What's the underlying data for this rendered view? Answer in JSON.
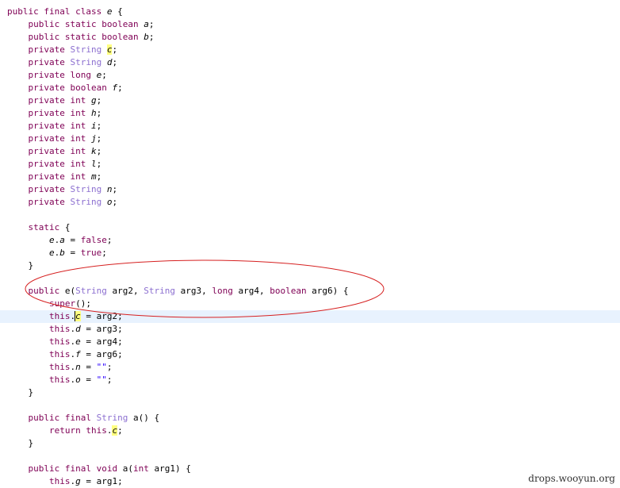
{
  "editor": {
    "lines": [
      "public final class e {",
      "    public static boolean a;",
      "    public static boolean b;",
      "    private String c;",
      "    private String d;",
      "    private long e;",
      "    private boolean f;",
      "    private int g;",
      "    private int h;",
      "    private int i;",
      "    private int j;",
      "    private int k;",
      "    private int l;",
      "    private int m;",
      "    private String n;",
      "    private String o;",
      "",
      "    static {",
      "        e.a = false;",
      "        e.b = true;",
      "    }",
      "",
      "    public e(String arg2, String arg3, long arg4, boolean arg6) {",
      "        super();",
      "        this.c = arg2;",
      "        this.d = arg3;",
      "        this.e = arg4;",
      "        this.f = arg6;",
      "        this.n = \"\";",
      "        this.o = \"\";",
      "    }",
      "",
      "    public final String a() {",
      "        return this.c;",
      "    }",
      "",
      "    public final void a(int arg1) {",
      "        this.g = arg1;"
    ],
    "current_line": 24
  },
  "colors": {
    "keyword": "#7f0055",
    "type": "#8c6fd0",
    "string": "#2a00ff",
    "highlight": "#ffff80",
    "current_line": "#e8f2fe",
    "annotation": "#d62020"
  },
  "watermark": "drops.wooyun.org"
}
